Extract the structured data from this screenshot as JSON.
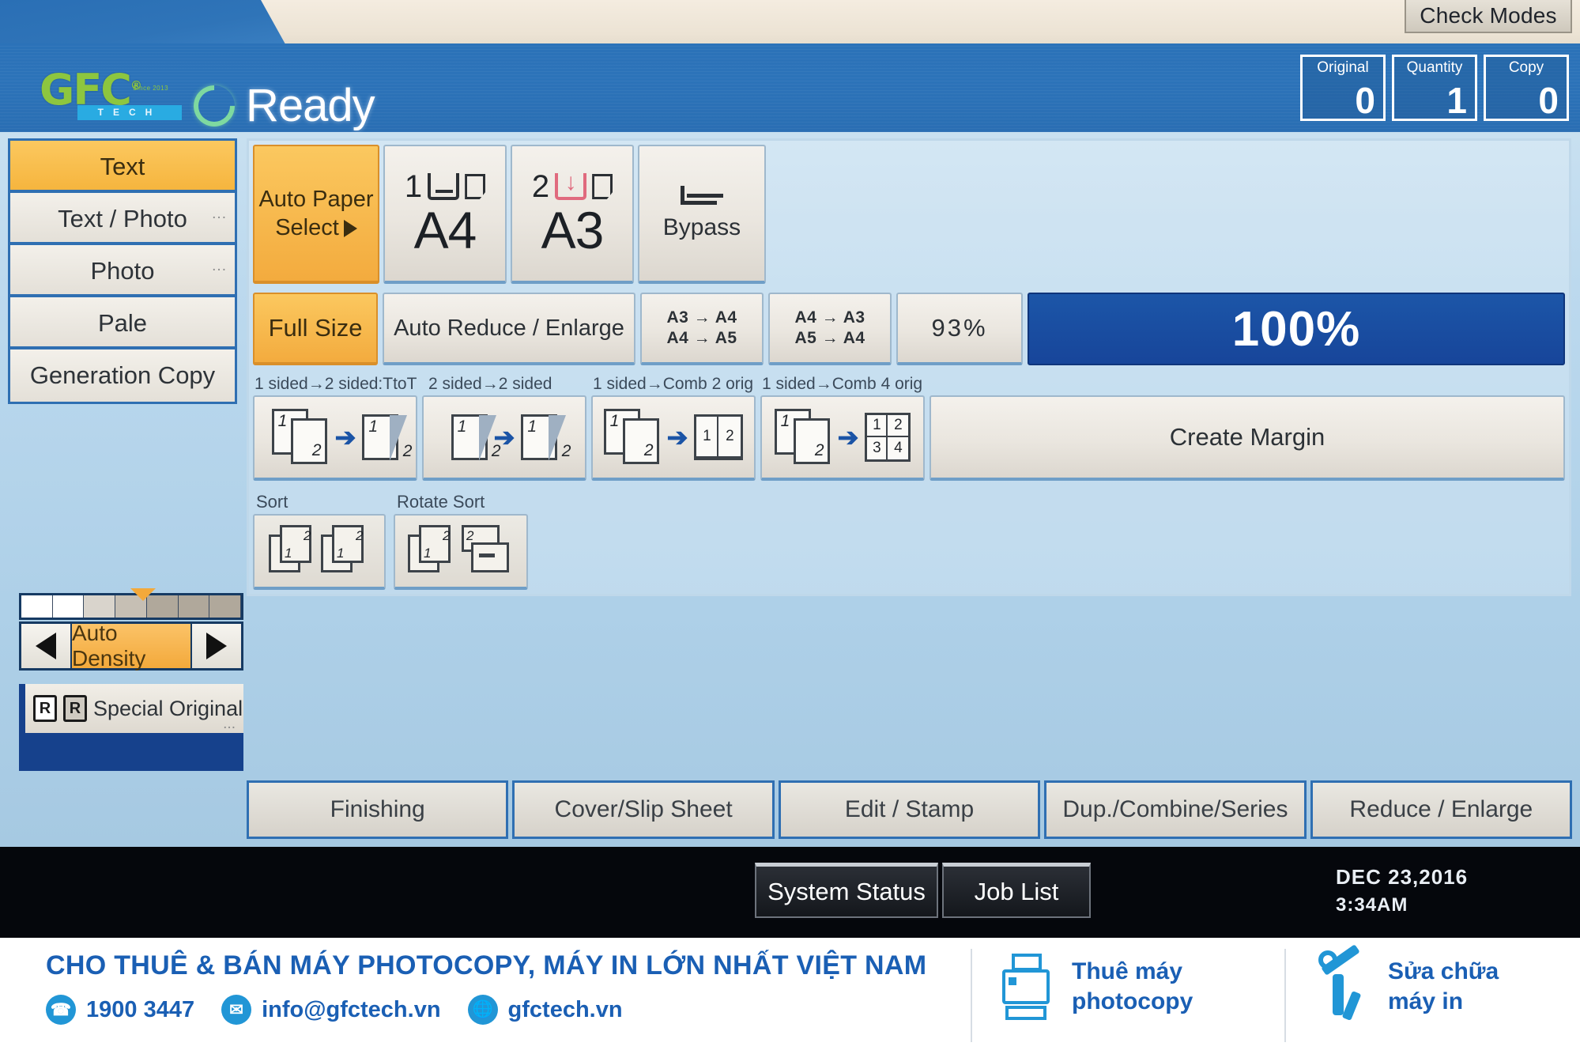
{
  "brand": {
    "logo_main": "GFC",
    "logo_reg": "®",
    "logo_since": "Since 2013",
    "logo_sub": "TECH"
  },
  "bezel": {
    "check_modes": "Check Modes"
  },
  "header": {
    "status": "Ready",
    "status_icon": "power-ring-icon",
    "counters": [
      {
        "label": "Original",
        "value": "0"
      },
      {
        "label": "Quantity",
        "value": "1"
      },
      {
        "label": "Copy",
        "value": "0"
      }
    ]
  },
  "image_quality": {
    "items": [
      {
        "label": "Text",
        "selected": true,
        "dots": ""
      },
      {
        "label": "Text / Photo",
        "selected": false,
        "dots": "..."
      },
      {
        "label": "Photo",
        "selected": false,
        "dots": "..."
      },
      {
        "label": "Pale",
        "selected": false,
        "dots": ""
      },
      {
        "label": "Generation Copy",
        "selected": false,
        "dots": ""
      }
    ]
  },
  "density": {
    "label": "Auto Density",
    "left_arrow": "left-arrow-icon",
    "right_arrow": "right-arrow-icon",
    "marker_position": "center"
  },
  "special_original": {
    "label": "Special Original",
    "dots": "...",
    "icon_left": "R",
    "icon_right": "R"
  },
  "paper_select": {
    "auto_label_line1": "Auto Paper",
    "auto_label_line2": "Select",
    "trays": [
      {
        "num": "1",
        "size": "A4",
        "orientation": "landscape-glass",
        "highlight": false
      },
      {
        "num": "2",
        "size": "A3",
        "orientation": "portrait-glass",
        "highlight": true
      }
    ],
    "bypass_label": "Bypass"
  },
  "reduce_enlarge": {
    "full_size": "Full Size",
    "auto": "Auto Reduce / Enlarge",
    "ratios": [
      {
        "line1": "A3 → A4",
        "line2": "A4 → A5"
      },
      {
        "line1": "A4 → A3",
        "line2": "A5 → A4"
      }
    ],
    "preset_93": "93%",
    "current": "100%"
  },
  "duplex": {
    "labels": [
      "1 sided→2 sided:TtoT",
      "2 sided→2 sided",
      "1 sided→Comb 2 orig",
      "1 sided→Comb 4 orig"
    ],
    "create_margin": "Create Margin",
    "page_numbers": {
      "one": "1",
      "two": "2",
      "three": "3",
      "four": "4"
    }
  },
  "sort": {
    "sort_label": "Sort",
    "rotate_sort_label": "Rotate Sort"
  },
  "function_tabs": [
    "Finishing",
    "Cover/Slip Sheet",
    "Edit / Stamp",
    "Dup./Combine/Series",
    "Reduce / Enlarge"
  ],
  "status_bar": {
    "system_status": "System Status",
    "job_list": "Job List",
    "date": "DEC  23,2016",
    "time": "3:34AM"
  },
  "banner": {
    "headline": "CHO THUÊ & BÁN MÁY PHOTOCOPY, MÁY IN LỚN NHẤT VIỆT NAM",
    "phone": "1900 3447",
    "email": "info@gfctech.vn",
    "website": "gfctech.vn",
    "phone_icon": "phone-icon",
    "email_icon": "envelope-icon",
    "web_icon": "globe-icon",
    "service1_line1": "Thuê máy",
    "service1_line2": "photocopy",
    "service2_line1": "Sửa chữa",
    "service2_line2": "máy in"
  },
  "colors": {
    "accent_blue": "#2b72b8",
    "selected_orange": "#f6b53e",
    "active_blue": "#17459a",
    "brand_green": "#8dc63f",
    "brand_cyan": "#29abe2"
  }
}
